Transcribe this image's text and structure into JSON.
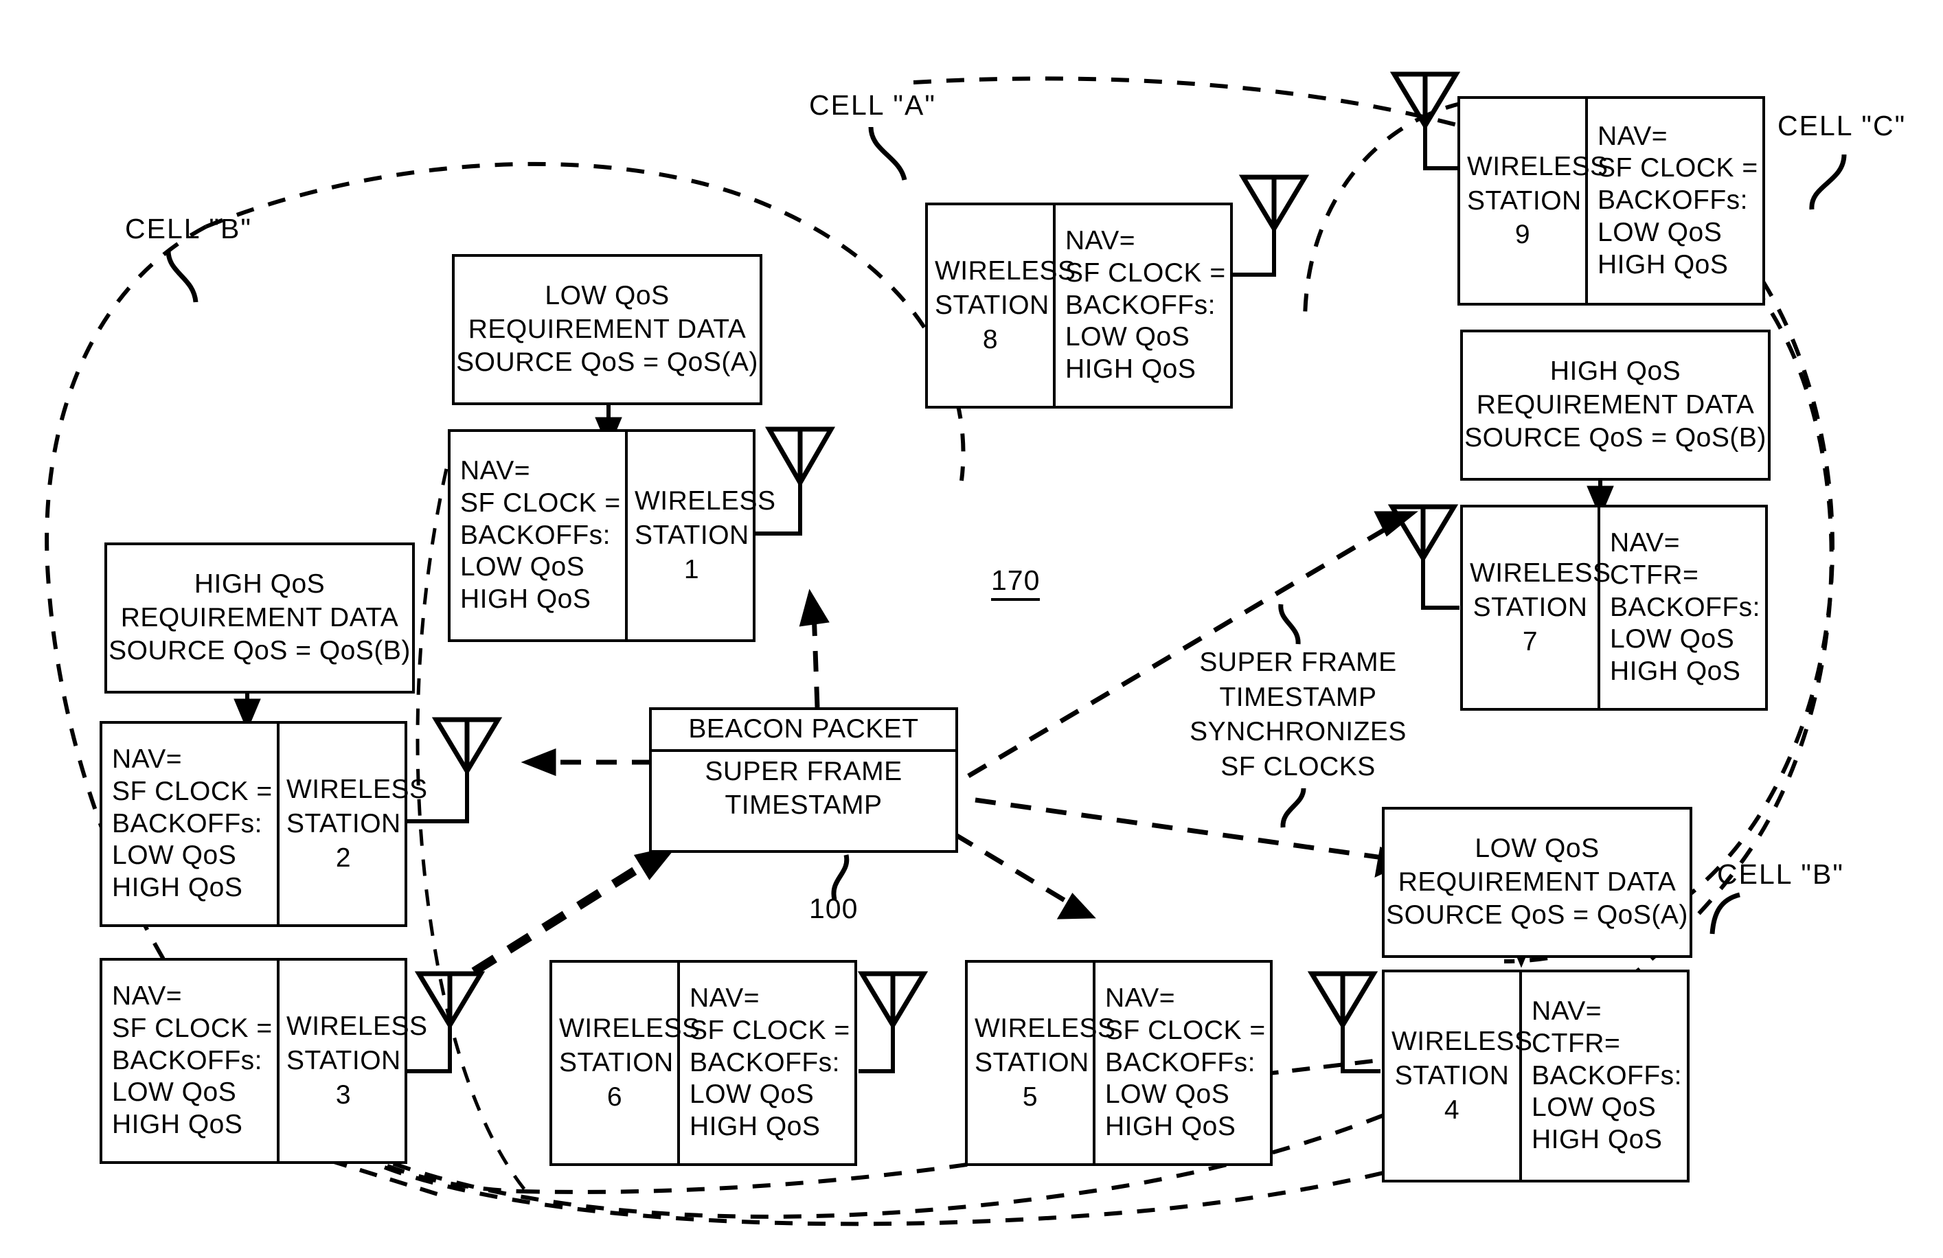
{
  "figure": {
    "ref_number_main": "170",
    "ref_number_beacon": "100"
  },
  "cell_labels": [
    {
      "name": "cell-label-a",
      "text": "CELL  \"A\""
    },
    {
      "name": "cell-label-b-top",
      "text": "CELL  \"B\""
    },
    {
      "name": "cell-label-c",
      "text": "CELL  \"C\""
    },
    {
      "name": "cell-label-b-bottom",
      "text": "CELL  \"B\""
    }
  ],
  "nav_fields": {
    "nav": "NAV=",
    "sf_clock": "SF CLOCK =",
    "ctfr": "CTFR=",
    "backoffs": "BACKOFFs:",
    "low_qos": "LOW QoS",
    "high_qos": "HIGH QoS"
  },
  "station_label": {
    "line1": "WIRELESS",
    "line2": "STATION"
  },
  "stations": [
    {
      "id": "1",
      "order": "nav-first",
      "clock_field": "SF CLOCK =",
      "line1": "WIRELESS",
      "line2": "STATION",
      "number": "1"
    },
    {
      "id": "2",
      "order": "nav-first",
      "clock_field": "SF CLOCK =",
      "line1": "WIRELESS",
      "line2": "STATION",
      "number": "2"
    },
    {
      "id": "3",
      "order": "nav-first",
      "clock_field": "SF CLOCK =",
      "line1": "WIRELESS",
      "line2": "STATION",
      "number": "3"
    },
    {
      "id": "4",
      "order": "station-first",
      "clock_field": "CTFR=",
      "line1": "WIRELESS",
      "line2": "STATION",
      "number": "4"
    },
    {
      "id": "5",
      "order": "station-first",
      "clock_field": "SF CLOCK =",
      "line1": "WIRELESS",
      "line2": "STATION",
      "number": "5"
    },
    {
      "id": "6",
      "order": "station-first",
      "clock_field": "SF CLOCK =",
      "line1": "WIRELESS",
      "line2": "STATION",
      "number": "6"
    },
    {
      "id": "7",
      "order": "station-first",
      "clock_field": "CTFR=",
      "line1": "WIRELESS",
      "line2": "STATION",
      "number": "7"
    },
    {
      "id": "8",
      "order": "station-first",
      "clock_field": "SF CLOCK =",
      "line1": "WIRELESS",
      "line2": "STATION",
      "number": "8"
    },
    {
      "id": "9",
      "order": "station-first",
      "clock_field": "SF CLOCK =",
      "line1": "WIRELESS",
      "line2": "STATION",
      "number": "9"
    }
  ],
  "requirement_boxes": [
    {
      "id": "low-a-left",
      "l1": "LOW QoS",
      "l2": "REQUIREMENT DATA",
      "l3": "SOURCE QoS = QoS(A)"
    },
    {
      "id": "high-b-left",
      "l1": "HIGH QoS",
      "l2": "REQUIREMENT DATA",
      "l3": "SOURCE QoS = QoS(B)"
    },
    {
      "id": "high-b-right",
      "l1": "HIGH QoS",
      "l2": "REQUIREMENT DATA",
      "l3": "SOURCE QoS = QoS(B)"
    },
    {
      "id": "low-a-right",
      "l1": "LOW QoS",
      "l2": "REQUIREMENT DATA",
      "l3": "SOURCE QoS = QoS(A)"
    }
  ],
  "beacon_packet": {
    "header": "BEACON PACKET",
    "body_line1": "SUPER FRAME",
    "body_line2": "TIMESTAMP"
  },
  "annotation": {
    "line1": "SUPER FRAME",
    "line2": "TIMESTAMP",
    "line3": "SYNCHRONIZES",
    "line4": "SF CLOCKS"
  },
  "colors": {
    "ink": "#000000",
    "paper": "#ffffff"
  }
}
